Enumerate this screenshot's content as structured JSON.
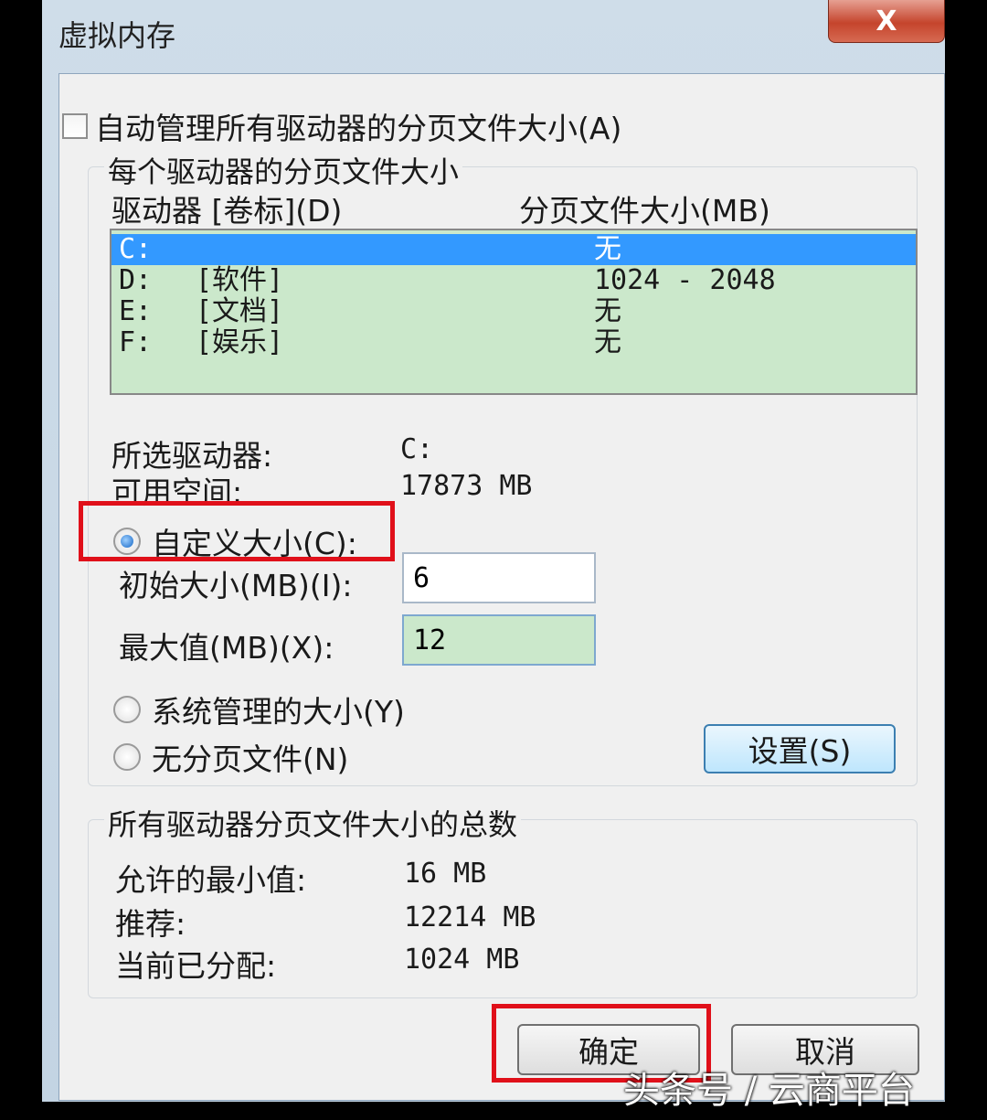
{
  "window": {
    "title": "虚拟内存",
    "close_label": "X"
  },
  "auto_manage": {
    "label": "自动管理所有驱动器的分页文件大小(A)",
    "checked": false
  },
  "per_drive": {
    "legend": "每个驱动器的分页文件大小",
    "col_drive": "驱动器 [卷标](D)",
    "col_size": "分页文件大小(MB)",
    "drives": [
      {
        "drive": "C:",
        "label": "",
        "size": "无",
        "selected": true
      },
      {
        "drive": "D:",
        "label": "[软件]",
        "size": "1024 - 2048",
        "selected": false
      },
      {
        "drive": "E:",
        "label": "[文档]",
        "size": "无",
        "selected": false
      },
      {
        "drive": "F:",
        "label": "[娱乐]",
        "size": "无",
        "selected": false
      }
    ],
    "selected_drive_label": "所选驱动器:",
    "selected_drive_value": "C:",
    "free_space_label": "可用空间:",
    "free_space_value": "17873 MB",
    "custom_size_label": "自定义大小(C):",
    "initial_size_label": "初始大小(MB)(I):",
    "initial_size_value": "6",
    "max_size_label": "最大值(MB)(X):",
    "max_size_value": "12",
    "system_managed_label": "系统管理的大小(Y)",
    "no_paging_label": "无分页文件(N)",
    "set_button": "设置(S)",
    "selected_option": "custom"
  },
  "totals": {
    "legend": "所有驱动器分页文件大小的总数",
    "min_label": "允许的最小值:",
    "min_value": "16 MB",
    "recommended_label": "推荐:",
    "recommended_value": "12214 MB",
    "current_label": "当前已分配:",
    "current_value": "1024 MB"
  },
  "buttons": {
    "ok": "确定",
    "cancel": "取消"
  },
  "watermark": "头条号 / 云商平台",
  "colors": {
    "selection": "#3399ff",
    "list_bg": "#cbe8cb",
    "highlight_box": "#e0101a"
  }
}
